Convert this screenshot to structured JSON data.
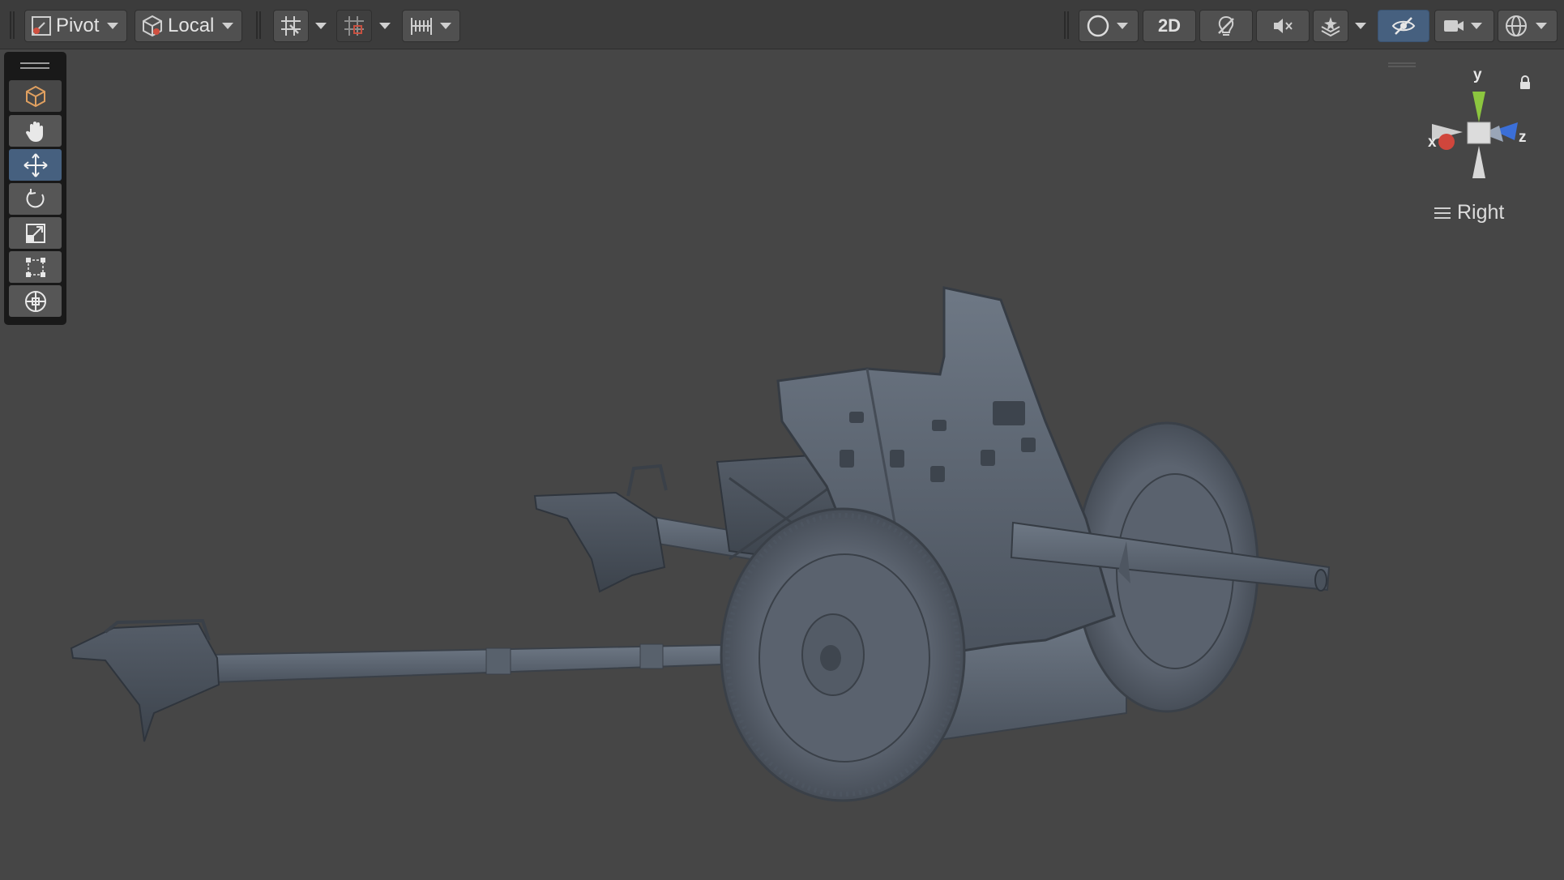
{
  "toolbar": {
    "pivot_label": "Pivot",
    "local_label": "Local",
    "mode_2d_label": "2D"
  },
  "tools": [
    {
      "name": "view-tool",
      "icon": "cube-icon"
    },
    {
      "name": "hand-tool",
      "icon": "hand-icon"
    },
    {
      "name": "move-tool",
      "icon": "move-arrows-icon",
      "active": true
    },
    {
      "name": "rotate-tool",
      "icon": "rotate-icon"
    },
    {
      "name": "scale-tool",
      "icon": "scale-icon"
    },
    {
      "name": "rect-tool",
      "icon": "rect-transform-icon"
    },
    {
      "name": "transform-tool",
      "icon": "transform-icon"
    }
  ],
  "gizmo": {
    "x_label": "x",
    "y_label": "y",
    "z_label": "z",
    "view_label": "Right"
  },
  "colors": {
    "viewport_bg": "#464646",
    "toolbar_bg": "#3c3c3c",
    "active_blue": "#46607f",
    "axis_x": "#d0463c",
    "axis_y": "#8cc63f",
    "axis_z": "#3b6fd8",
    "model_steel": "#5d6673"
  }
}
